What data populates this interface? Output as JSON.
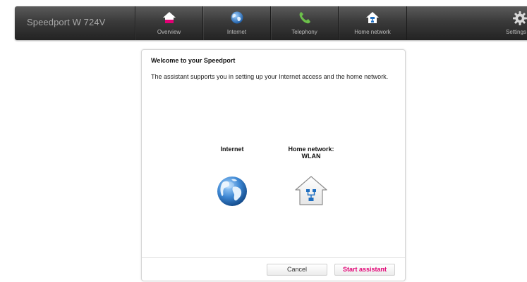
{
  "header": {
    "device_name": "Speedport W 724V",
    "nav": [
      {
        "label": "Overview",
        "icon": "house-icon"
      },
      {
        "label": "Internet",
        "icon": "globe-icon"
      },
      {
        "label": "Telephony",
        "icon": "phone-icon"
      },
      {
        "label": "Home network",
        "icon": "home-network-icon"
      }
    ],
    "settings_label": "Settings"
  },
  "dialog": {
    "title": "Welcome to your Speedport",
    "description": "The assistant supports you in setting up your Internet access and the home network.",
    "options": [
      {
        "label": "Internet",
        "icon": "globe-icon"
      },
      {
        "label": "Home network:\nWLAN",
        "icon": "home-network-icon"
      }
    ],
    "buttons": {
      "cancel": "Cancel",
      "start": "Start assistant"
    }
  },
  "colors": {
    "accent": "#e20074",
    "topbar": "#3a3a3a"
  }
}
